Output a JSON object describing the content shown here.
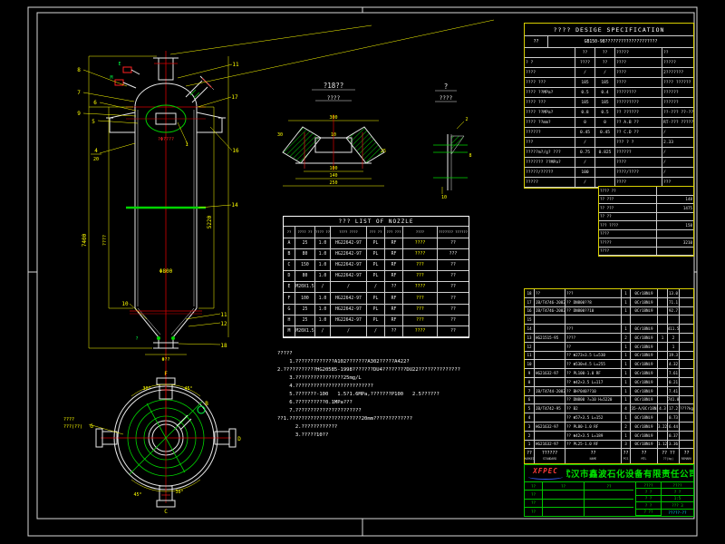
{
  "spec": {
    "title": "????   DESIGE   SPECIFICATION",
    "code_label": "??",
    "code_value": "GB150-98????????????????????",
    "rows": [
      {
        "l": "",
        "v1": "??",
        "v2": "??",
        "r1": "?????",
        "r2": "??"
      },
      {
        "l": "? ?",
        "v1": "????",
        "v2": "??",
        "r1": "????",
        "r2": "?????"
      },
      {
        "l": "????",
        "v1": "/",
        "v2": "/",
        "r1": "????",
        "r2": "2???????"
      },
      {
        "l": "???? ???",
        "v1": "185",
        "v2": "185",
        "r1": "????",
        "r2": "???? ??????"
      },
      {
        "l": "???? ??MPa?",
        "v1": "0.5",
        "v2": "0.4",
        "r1": "????????",
        "r2": "??????"
      },
      {
        "l": "???? ???",
        "v1": "185",
        "v2": "185",
        "r1": "?????????",
        "r2": "??????"
      },
      {
        "l": "???? ??MPa?",
        "v1": "0.8",
        "v2": "0.5",
        "r1": "?? ??????",
        "r2": "??-??? ??-??"
      },
      {
        "l": "???? ??mm?",
        "v1": "0",
        "v2": "0",
        "r1": "?? A.B ??",
        "r2": "RT-??? ??????"
      },
      {
        "l": "??????",
        "v1": "0.45",
        "v2": "0.45",
        "r1": "?? C.D ??",
        "r2": "/"
      },
      {
        "l": "???",
        "v1": "/",
        "v2": "",
        "r1": "??? ? ?",
        "r2": "2.33"
      },
      {
        "l": "?????m?/g? ???",
        "v1": "0.75",
        "v2": "0.825",
        "r1": "??????",
        "r2": "/"
      },
      {
        "l": "??????? ??MPa?",
        "v1": "/",
        "v2": "",
        "r1": "????",
        "r2": "/"
      },
      {
        "l": "?????/?????",
        "v1": "100",
        "v2": "",
        "r1": "????/????",
        "r2": "/"
      },
      {
        "l": "?????",
        "v1": "/",
        "v2": "",
        "r1": "????",
        "r2": "???"
      }
    ]
  },
  "small_table": {
    "rows": [
      {
        "l": "???? ??",
        "v": ""
      },
      {
        "l": "?? ???",
        "v": "148"
      },
      {
        "l": "?? ???",
        "v": "1475"
      },
      {
        "l": "?? ??",
        "v": ""
      },
      {
        "l": "??? ????",
        "v": "158"
      },
      {
        "l": "????",
        "v": ""
      },
      {
        "l": "?????",
        "v": "3210"
      },
      {
        "l": "????",
        "v": ""
      }
    ]
  },
  "nozzle_table": {
    "title": "???   LIST   OF   NOZZLE",
    "head": {
      "s": "??",
      "dn": "???? ??",
      "pn": "???? ??",
      "std": "???? ????",
      "ty": "??? ??",
      "f": "??? ???",
      "p": "????",
      "c": "??????? ??????"
    },
    "rows": [
      {
        "s": "A",
        "dn": "25",
        "pn": "1.0",
        "std": "HG22642-97",
        "ty": "PL",
        "f": "RF",
        "p": "????",
        "c": "??"
      },
      {
        "s": "B",
        "dn": "80",
        "pn": "1.0",
        "std": "HG22642-97",
        "ty": "PL",
        "f": "RF",
        "p": "????",
        "c": "???"
      },
      {
        "s": "C",
        "dn": "150",
        "pn": "1.0",
        "std": "HG22642-97",
        "ty": "PL",
        "f": "RF",
        "p": "???",
        "c": "??"
      },
      {
        "s": "D",
        "dn": "80",
        "pn": "1.0",
        "std": "HG22642-97",
        "ty": "PL",
        "f": "RF",
        "p": "???",
        "c": "??"
      },
      {
        "s": "E",
        "dn": "M20X1.5",
        "pn": "/",
        "std": "/",
        "ty": "/",
        "f": "??",
        "p": "????",
        "c": "??"
      },
      {
        "s": "F",
        "dn": "100",
        "pn": "1.0",
        "std": "HG22642-97",
        "ty": "PL",
        "f": "RF",
        "p": "???",
        "c": "??"
      },
      {
        "s": "G",
        "dn": "25",
        "pn": "1.0",
        "std": "HG22642-97",
        "ty": "PL",
        "f": "RF",
        "p": "???",
        "c": "??"
      },
      {
        "s": "H",
        "dn": "25",
        "pn": "1.0",
        "std": "HG22642-97",
        "ty": "PL",
        "f": "RF",
        "p": "???",
        "c": "??"
      },
      {
        "s": "M",
        "dn": "M20X1.5",
        "pn": "/",
        "std": "/",
        "ty": "/",
        "f": "??",
        "p": "????",
        "c": "??"
      }
    ]
  },
  "notes": {
    "lines": [
      {
        "t": "?????"
      },
      {
        "t": "    1.?????????????A102???????A302?????A422?"
      },
      {
        "t": ""
      },
      {
        "t": "2.???????????HG20585-1998???????DU4????????DU22??????????????"
      },
      {
        "t": "    3.????????????????25mg/L"
      },
      {
        "t": "    4.??????????????????????????"
      },
      {
        "t": "    5.???????-100   1.5?1.6MPa,???????P100   2.5??????"
      },
      {
        "t": "    6.??????????0.1MPa???"
      },
      {
        "t": "    7.??????????????????????"
      },
      {
        "t": ""
      },
      {
        "t": "??1.????????????????????????20mm?????????????"
      },
      {
        "t": "      2.????????????"
      },
      {
        "t": "      3.?????10??"
      }
    ]
  },
  "bom": {
    "rows": [
      {
        "n": "18",
        "std": "??",
        "nm": "???",
        "q": "1",
        "m": "0Cr18Ni9",
        "uw": "",
        "tw": "13.0",
        "rk": ""
      },
      {
        "n": "17",
        "std": "JB/T4746-2002",
        "nm": "?? DN800??8",
        "q": "1",
        "m": "0Cr18Ni9",
        "uw": "",
        "tw": "71.1",
        "rk": ""
      },
      {
        "n": "16",
        "std": "JB/T4746-2002",
        "nm": "?? DN800??10",
        "q": "1",
        "m": "0Cr18Ni9",
        "uw": "",
        "tw": "92.7",
        "rk": ""
      },
      {
        "n": "15",
        "std": "",
        "nm": "",
        "q": "",
        "m": "",
        "uw": "",
        "tw": "",
        "rk": ""
      },
      {
        "n": "14",
        "std": "",
        "nm": "???",
        "q": "1",
        "m": "0Cr18Ni9",
        "uw": "",
        "tw": "411.5",
        "rk": ""
      },
      {
        "n": "13",
        "std": "HG21515-95",
        "nm": "????",
        "q": "2",
        "m": "0Cr18Ni9",
        "uw": "1",
        "tw": "2",
        "rk": ""
      },
      {
        "n": "12",
        "std": "",
        "nm": "??",
        "q": "1",
        "m": "0Cr18Ni9",
        "uw": "",
        "tw": "1",
        "rk": ""
      },
      {
        "n": "11",
        "std": "",
        "nm": "?? Φ273×3.5 L=530",
        "q": "1",
        "m": "0Cr18Ni9",
        "uw": "",
        "tw": "19.3",
        "rk": ""
      },
      {
        "n": "10",
        "std": "",
        "nm": "?? Φ530×4.5 L=255",
        "q": "1",
        "m": "0Cr18Ni9",
        "uw": "",
        "tw": "4.32",
        "rk": ""
      },
      {
        "n": "9",
        "std": "HG21632-97",
        "nm": "?? PL100-1.0 RF",
        "q": "1",
        "m": "0Cr18Ni9",
        "uw": "",
        "tw": "7.61",
        "rk": ""
      },
      {
        "n": "8",
        "std": "",
        "nm": "?? Φ42×3.5 L=117",
        "q": "1",
        "m": "0Cr18Ni9",
        "uw": "",
        "tw": "0.21",
        "rk": ""
      },
      {
        "n": "7",
        "std": "JB/T4744-2002",
        "nm": "?? BH?040??10",
        "q": "1",
        "m": "0Cr18Ni9",
        "uw": "",
        "tw": "7.41",
        "rk": ""
      },
      {
        "n": "6",
        "std": "",
        "nm": "?? DN800 ?=10 H=5220",
        "q": "1",
        "m": "0Cr18Ni9",
        "uw": "",
        "tw": "741.8",
        "rk": ""
      },
      {
        "n": "5",
        "std": "JB/T4742-95",
        "nm": "?? B2",
        "q": "4",
        "m": "Q235-A/0Cr18Ni9",
        "uw": "4.3",
        "tw": "17.2",
        "rk": "????kg"
      },
      {
        "n": "4",
        "std": "",
        "nm": "?? Φ57×3.5 L=152",
        "q": "1",
        "m": "0Cr18Ni9",
        "uw": "",
        "tw": "0.73",
        "rk": ""
      },
      {
        "n": "3",
        "std": "HG21632-97",
        "nm": "?? PL80-1.0 RF",
        "q": "2",
        "m": "0Cr18Ni9",
        "uw": "3.22",
        "tw": "6.44",
        "rk": ""
      },
      {
        "n": "2",
        "std": "",
        "nm": "?? Φ42×3.5 L=189",
        "q": "1",
        "m": "0Cr18Ni9",
        "uw": "",
        "tw": "0.37",
        "rk": ""
      },
      {
        "n": "1",
        "std": "HG21632-97",
        "nm": "?? PL25-1.0 RF",
        "q": "3",
        "m": "0Cr18Ni9",
        "uw": "1.12",
        "tw": "3.36",
        "rk": ""
      }
    ],
    "footer": {
      "n": "??",
      "n_en": "MARKED",
      "std": "??????",
      "std_en": "STANDARD",
      "nm": "??",
      "nm_en": "NAME",
      "q": "??",
      "q_en": "PCS",
      "m": "??",
      "m_en": "MTL",
      "w": "?? ??",
      "w_en": "??(kg)",
      "rk": "??",
      "rk_en": "REMARK"
    }
  },
  "title_block": {
    "logo": "XFPEC",
    "company": "武汉市鑫波石化设备有限责任公司",
    "left_rows": [
      {
        "a": "??",
        "b": "??",
        "c": "??"
      },
      {
        "a": "??",
        "b": "",
        "c": ""
      },
      {
        "a": "??",
        "b": "",
        "c": ""
      },
      {
        "a": "??",
        "b": "",
        "c": ""
      }
    ],
    "right_rows": [
      {
        "l": "????",
        "v": "????"
      },
      {
        "l": "? ?",
        "v": "? ?"
      },
      {
        "l": "? ?",
        "v": "1:5"
      },
      {
        "l": "? ?",
        "v": "??? 3"
      }
    ],
    "dwg_label": "? ??",
    "drawing_no": "?????-??"
  },
  "drawing": {
    "front_view": {
      "balloons": [
        "8",
        "7",
        "9",
        "6",
        "5",
        "4",
        "20",
        "11",
        "17",
        "16",
        "1",
        "14",
        "11",
        "12",
        "18",
        "10"
      ],
      "dims": {
        "total_h": "7400",
        "left2": "????",
        "shell_h": "5220",
        "diameter": "Φ800",
        "outlet": "Φ??"
      },
      "manhole_label": "?Φ????",
      "weld_tag": "?",
      "nozzle_e": "E",
      "nozzle_m": "M"
    },
    "plan_view": {
      "angles": [
        "30°",
        "45°",
        "30°",
        "45°"
      ],
      "letters": [
        "F",
        "D",
        "C",
        "G",
        "B"
      ],
      "side_note1": "????",
      "side_note2": "???(??)"
    },
    "detail_a": {
      "title": "?18??",
      "subtitle": "????",
      "dims": {
        "top": "300",
        "slope": "30",
        "mid": "10",
        "b1": "100",
        "b2": "140",
        "b3": "250",
        "right": "25"
      }
    },
    "detail_b": {
      "title": "?",
      "subtitle": "????",
      "d1": "2",
      "d2": "8",
      "d3": "10"
    }
  }
}
